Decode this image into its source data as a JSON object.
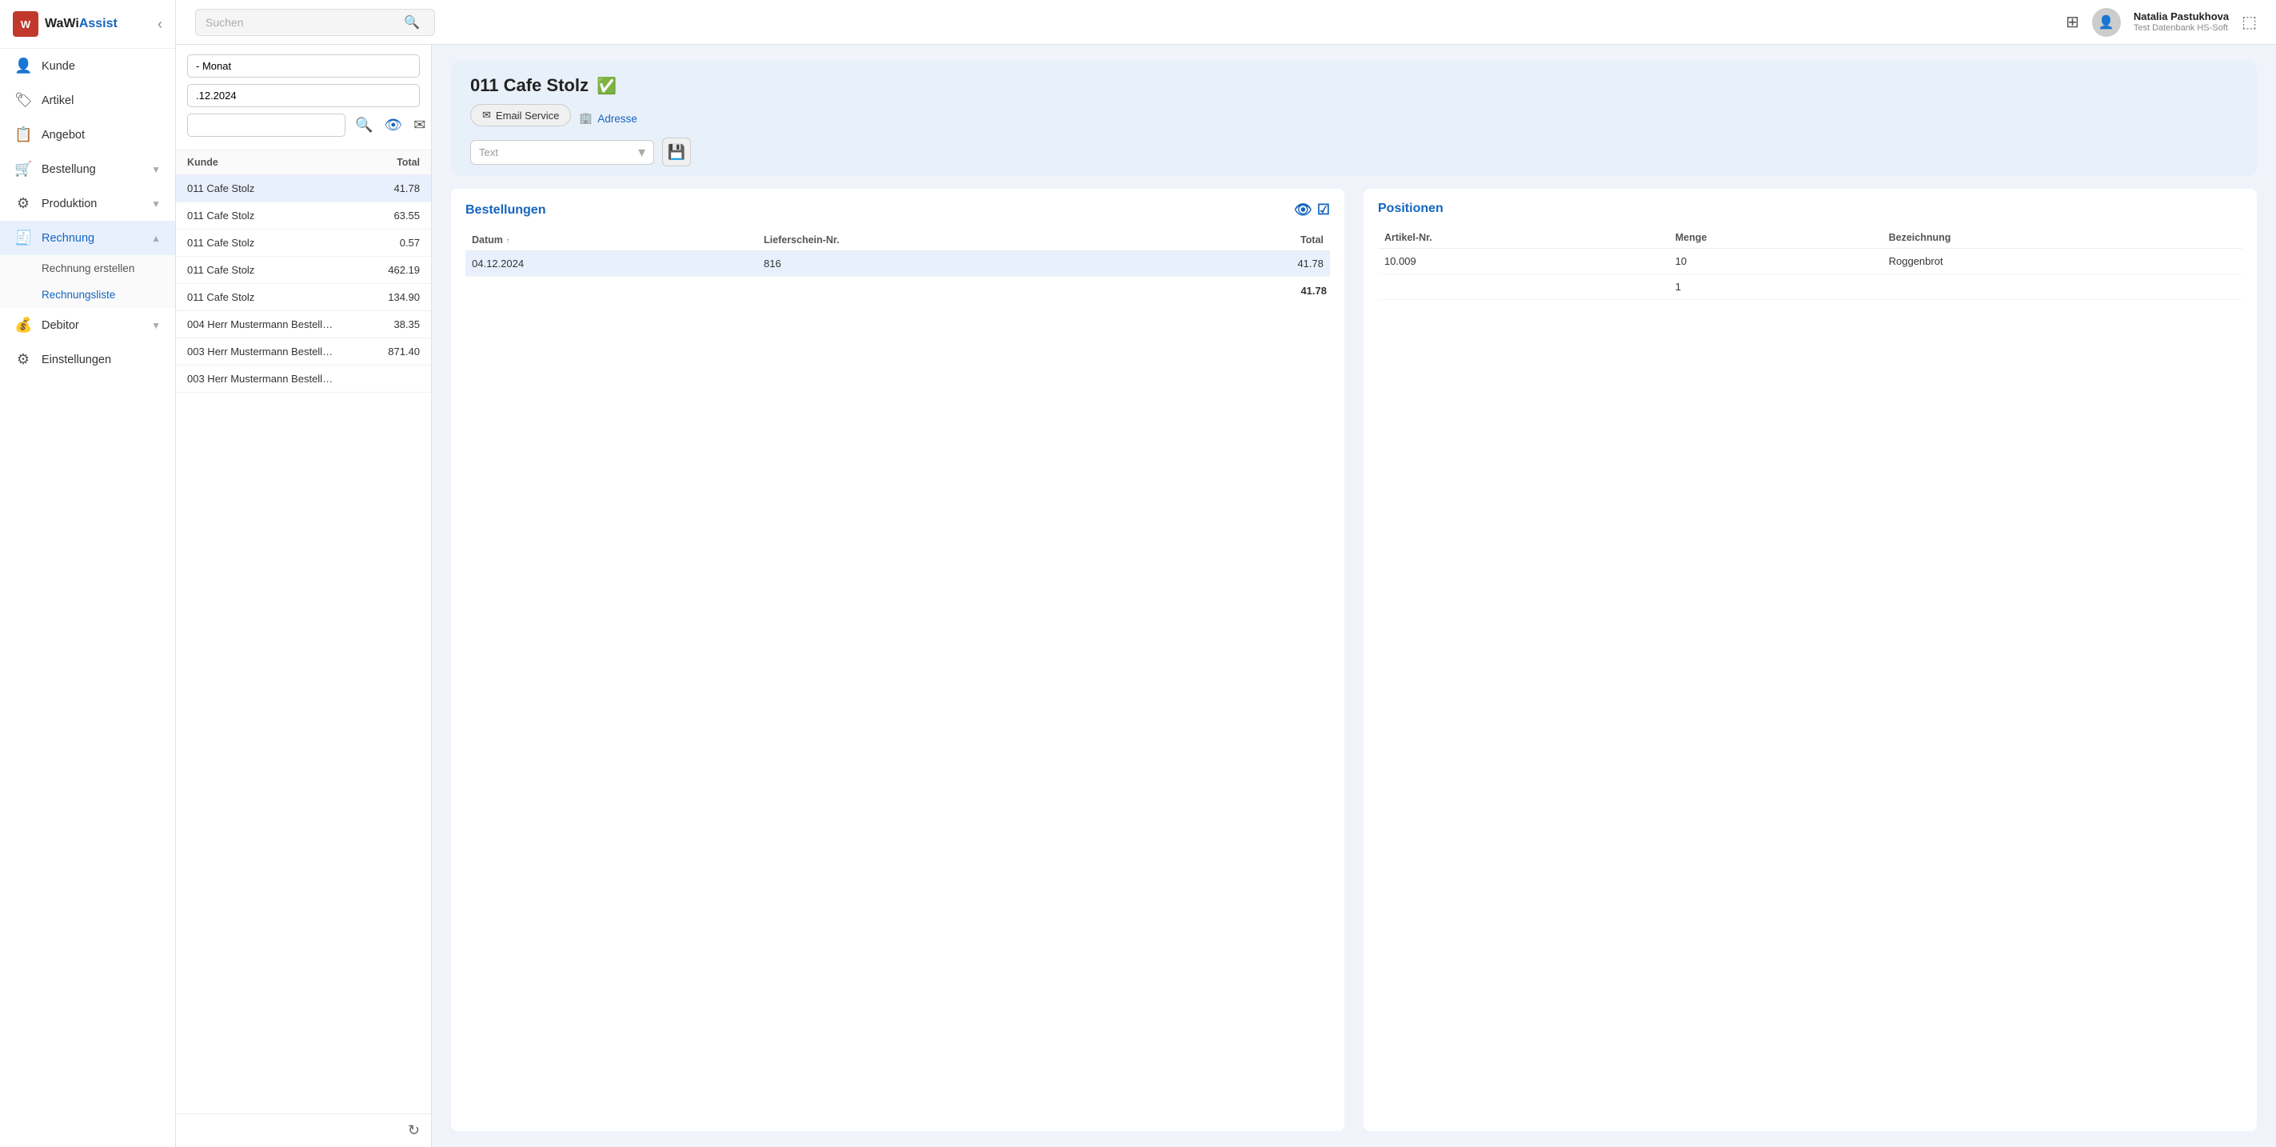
{
  "app": {
    "name": "WaWi",
    "name_highlight": "Assist",
    "logo_text": "W"
  },
  "topbar": {
    "search_placeholder": "Suchen",
    "user_name": "Natalia Pastukhova",
    "user_db": "Test Datenbank HS-Soft"
  },
  "sidebar": {
    "collapse_label": "‹",
    "items": [
      {
        "id": "kunde",
        "label": "Kunde",
        "icon": "👤"
      },
      {
        "id": "artikel",
        "label": "Artikel",
        "icon": "🏷"
      },
      {
        "id": "angebot",
        "label": "Angebot",
        "icon": "📋"
      },
      {
        "id": "bestellung",
        "label": "Bestellung",
        "icon": "🛒",
        "has_children": true
      },
      {
        "id": "produktion",
        "label": "Produktion",
        "icon": "⚙",
        "has_children": true
      },
      {
        "id": "rechnung",
        "label": "Rechnung",
        "icon": "🧾",
        "active": true,
        "has_children": true
      },
      {
        "id": "debitor",
        "label": "Debitor",
        "icon": "💰",
        "has_children": true
      },
      {
        "id": "einstellungen",
        "label": "Einstellungen",
        "icon": "⚙"
      }
    ],
    "sub_items_rechnung": [
      {
        "id": "rechnung-erstellen",
        "label": "Rechnung erstellen"
      },
      {
        "id": "rechnungsliste",
        "label": "Rechnungsliste",
        "active": true
      }
    ]
  },
  "list_panel": {
    "filter_monat": "- Monat",
    "filter_date": ".12.2024",
    "filter_search_placeholder": "",
    "columns": {
      "kunde": "Kunde",
      "total": "Total"
    },
    "rows": [
      {
        "kunde": "011 Cafe Stolz",
        "total": "41.78",
        "selected": true
      },
      {
        "kunde": "011 Cafe Stolz",
        "total": "63.55"
      },
      {
        "kunde": "011 Cafe Stolz",
        "total": "0.57"
      },
      {
        "kunde": "011 Cafe Stolz",
        "total": "462.19"
      },
      {
        "kunde": "011 Cafe Stolz",
        "total": "134.90"
      },
      {
        "kunde": "004 Herr Mustermann Bestell…",
        "total": "38.35"
      },
      {
        "kunde": "003 Herr Mustermann Bestell…",
        "total": "871.40"
      },
      {
        "kunde": "003 Herr Mustermann Bestell…",
        "total": ""
      }
    ]
  },
  "detail": {
    "customer_name": "011 Cafe Stolz",
    "email_service_label": "Email Service",
    "address_label": "Adresse",
    "text_label": "Text",
    "text_value": "",
    "save_icon": "💾",
    "bestellungen": {
      "title": "Bestellungen",
      "columns": {
        "datum": "Datum",
        "lieferschein": "Lieferschein-Nr.",
        "total": "Total"
      },
      "rows": [
        {
          "datum": "04.12.2024",
          "lieferschein": "816",
          "total": "41.78",
          "selected": true
        }
      ],
      "footer_total": "41.78"
    },
    "positionen": {
      "title": "Positionen",
      "columns": {
        "artikel_nr": "Artikel-Nr.",
        "menge": "Menge",
        "bezeichnung": "Bezeichnung"
      },
      "rows": [
        {
          "artikel_nr": "10.009",
          "menge": "10",
          "bezeichnung": "Roggenbrot"
        },
        {
          "artikel_nr": "",
          "menge": "1",
          "bezeichnung": ""
        }
      ]
    }
  }
}
